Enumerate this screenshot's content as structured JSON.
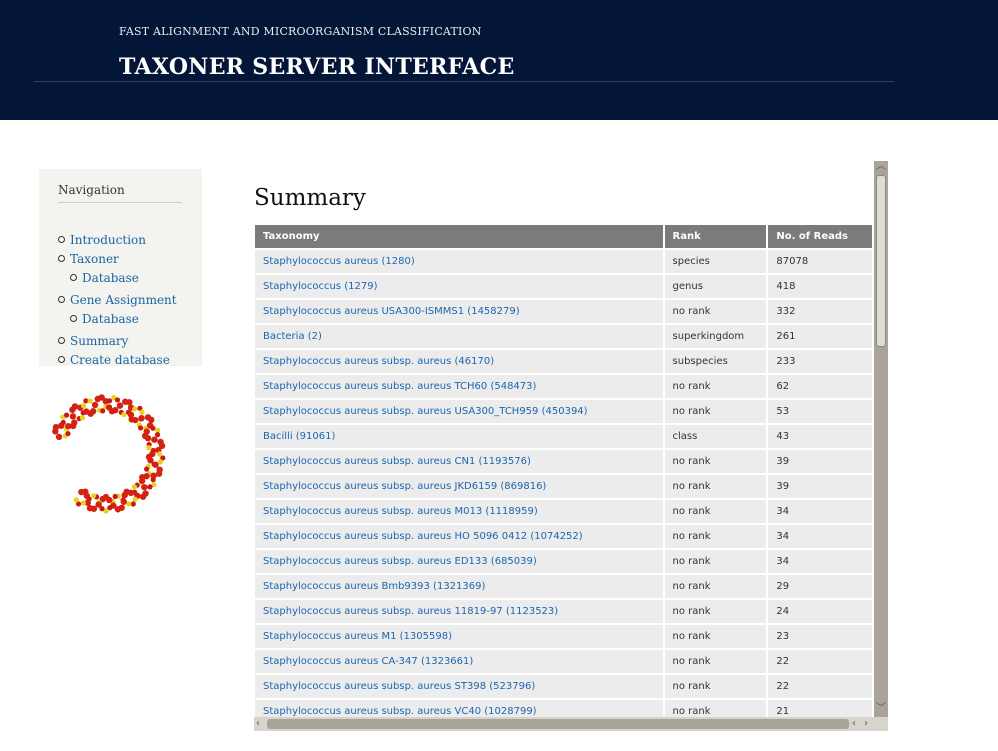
{
  "header": {
    "tagline": "FAST ALIGNMENT AND MICROORGANISM CLASSIFICATION",
    "title": "TAXONER SERVER INTERFACE"
  },
  "colors": {
    "header_bg": "#031638",
    "link": "#1a67b0",
    "table_header_bg": "#7b7b7b",
    "row_bg": "#ececec"
  },
  "navigation": {
    "heading": "Navigation",
    "items": [
      {
        "label": "Introduction",
        "level": 1
      },
      {
        "label": "Taxoner",
        "level": 1
      },
      {
        "label": "Database",
        "level": 2
      },
      {
        "label": "Gene Assignment",
        "level": 1
      },
      {
        "label": "Database",
        "level": 2
      },
      {
        "label": "Summary",
        "level": 1
      },
      {
        "label": "Create database",
        "level": 1
      }
    ]
  },
  "logo_icon": "dna-helix-icon",
  "summary": {
    "title": "Summary",
    "columns": [
      "Taxonomy",
      "Rank",
      "No. of Reads"
    ],
    "rows": [
      [
        "Staphylococcus aureus (1280)",
        "species",
        "87078"
      ],
      [
        "Staphylococcus (1279)",
        "genus",
        "418"
      ],
      [
        "Staphylococcus aureus USA300-ISMMS1 (1458279)",
        "no rank",
        "332"
      ],
      [
        "Bacteria (2)",
        "superkingdom",
        "261"
      ],
      [
        "Staphylococcus aureus subsp. aureus (46170)",
        "subspecies",
        "233"
      ],
      [
        "Staphylococcus aureus subsp. aureus TCH60 (548473)",
        "no rank",
        "62"
      ],
      [
        "Staphylococcus aureus subsp. aureus USA300_TCH959 (450394)",
        "no rank",
        "53"
      ],
      [
        "Bacilli (91061)",
        "class",
        "43"
      ],
      [
        "Staphylococcus aureus subsp. aureus CN1 (1193576)",
        "no rank",
        "39"
      ],
      [
        "Staphylococcus aureus subsp. aureus JKD6159 (869816)",
        "no rank",
        "39"
      ],
      [
        "Staphylococcus aureus subsp. aureus M013 (1118959)",
        "no rank",
        "34"
      ],
      [
        "Staphylococcus aureus subsp. aureus HO 5096 0412 (1074252)",
        "no rank",
        "34"
      ],
      [
        "Staphylococcus aureus subsp. aureus ED133 (685039)",
        "no rank",
        "34"
      ],
      [
        "Staphylococcus aureus Bmb9393 (1321369)",
        "no rank",
        "29"
      ],
      [
        "Staphylococcus aureus subsp. aureus 11819-97 (1123523)",
        "no rank",
        "24"
      ],
      [
        "Staphylococcus aureus M1 (1305598)",
        "no rank",
        "23"
      ],
      [
        "Staphylococcus aureus CA-347 (1323661)",
        "no rank",
        "22"
      ],
      [
        "Staphylococcus aureus subsp. aureus ST398 (523796)",
        "no rank",
        "22"
      ],
      [
        "Staphylococcus aureus subsp. aureus VC40 (1028799)",
        "no rank",
        "21"
      ]
    ]
  }
}
